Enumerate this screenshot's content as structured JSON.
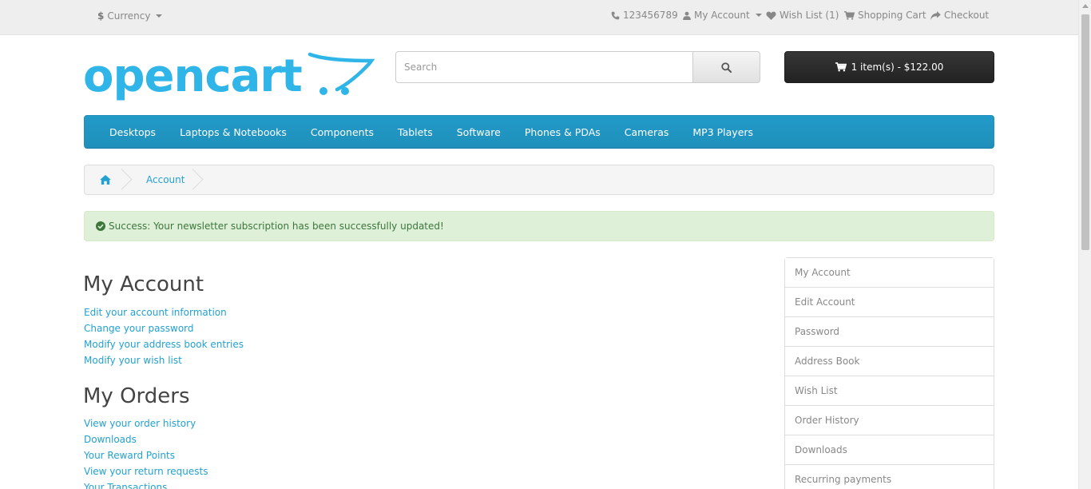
{
  "top_bar": {
    "currency_label": "Currency",
    "currency_symbol": "$",
    "phone": "123456789",
    "my_account": "My Account",
    "wish_list": "Wish List (1)",
    "shopping_cart": "Shopping Cart",
    "checkout": "Checkout"
  },
  "logo": {
    "text": "opencart"
  },
  "search": {
    "placeholder": "Search",
    "value": ""
  },
  "cart": {
    "label": "1 item(s) - $122.00"
  },
  "menu": {
    "items": [
      "Desktops",
      "Laptops & Notebooks",
      "Components",
      "Tablets",
      "Software",
      "Phones & PDAs",
      "Cameras",
      "MP3 Players"
    ]
  },
  "breadcrumb": {
    "account": "Account"
  },
  "alert": {
    "text": "Success: Your newsletter subscription has been successfully updated!"
  },
  "content": {
    "my_account": {
      "title": "My Account",
      "links": [
        "Edit your account information",
        "Change your password",
        "Modify your address book entries",
        "Modify your wish list"
      ]
    },
    "my_orders": {
      "title": "My Orders",
      "links": [
        "View your order history",
        "Downloads",
        "Your Reward Points",
        "View your return requests",
        "Your Transactions"
      ]
    }
  },
  "sidebar": {
    "items": [
      "My Account",
      "Edit Account",
      "Password",
      "Address Book",
      "Wish List",
      "Order History",
      "Downloads",
      "Recurring payments"
    ]
  },
  "colors": {
    "brand_blue": "#23a1d1",
    "menu_blue": "#229ac8",
    "success_bg": "#dff0d8",
    "success_text": "#3c763d",
    "cart_dark": "#2b2b2b"
  }
}
